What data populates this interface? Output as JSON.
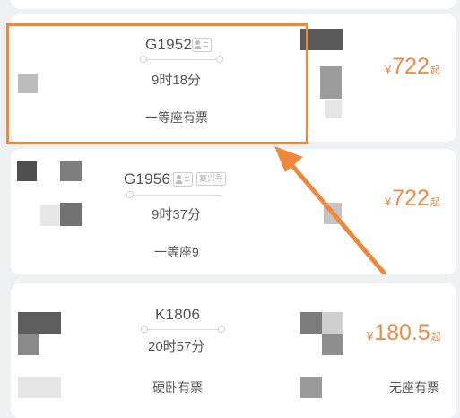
{
  "trains": [
    {
      "train_no": "G1952",
      "duration": "9时18分",
      "seat_info": "一等座有票",
      "price_symbol": "¥",
      "price": "722",
      "price_suffix": "起"
    },
    {
      "train_no": "G1956",
      "badge": "复兴号",
      "duration": "9时37分",
      "seat_info": "一等座9",
      "price_symbol": "¥",
      "price": "722",
      "price_suffix": "起"
    },
    {
      "train_no": "K1806",
      "duration": "20时57分",
      "seat_info": "硬卧有票",
      "seat_info_2": "无座有票",
      "price_symbol": "¥",
      "price": "180.5",
      "price_suffix": "起"
    }
  ],
  "annotation": {
    "color": "#f0883b",
    "target": "G1952"
  },
  "colors": {
    "price": "#f08a45",
    "background": "#eff0f2",
    "card": "#ffffff"
  },
  "icons": [
    "person-icon",
    "route-dot-icon",
    "arrow-icon"
  ]
}
